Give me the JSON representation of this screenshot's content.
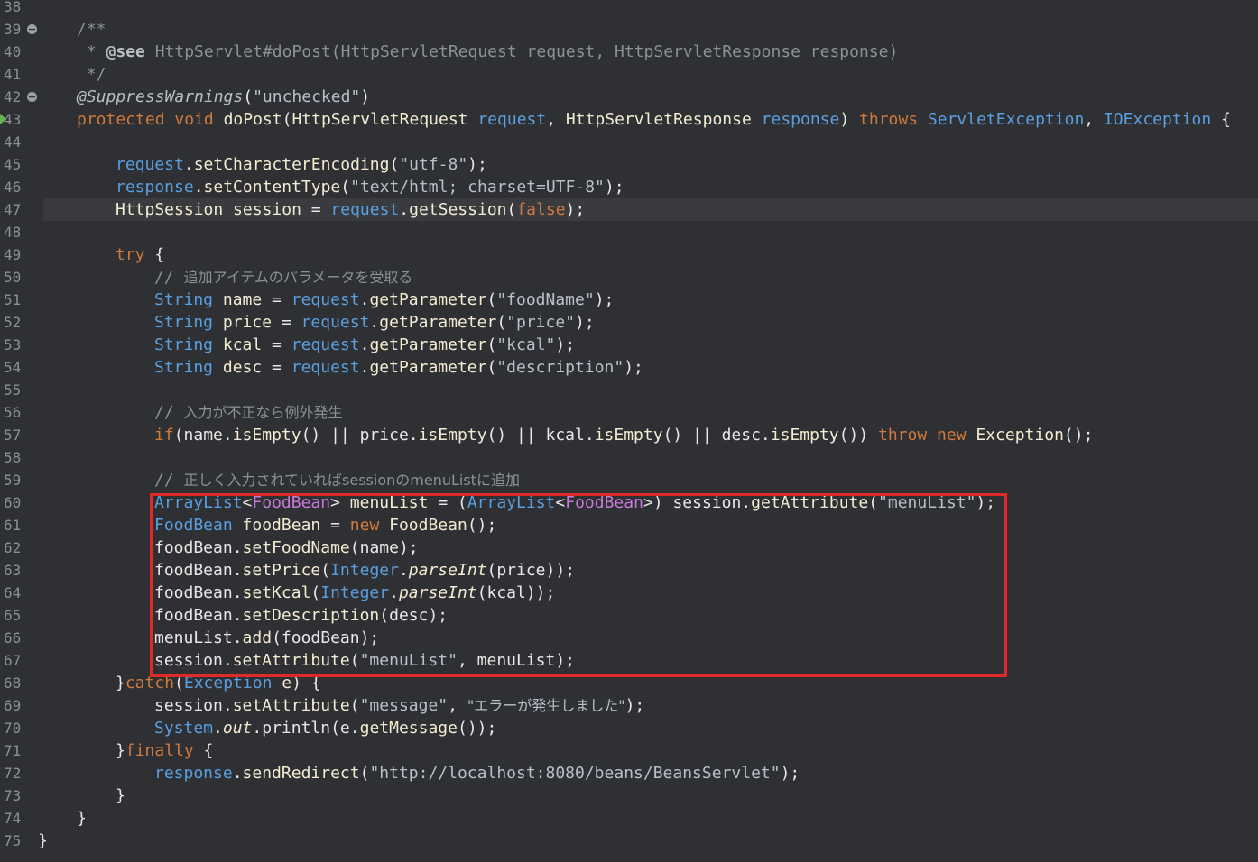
{
  "colors": {
    "background": "#2f3033",
    "highlight_box": "#e02a2a",
    "keyword": "#d07a3e",
    "type": "#5a9fe0",
    "comment": "#8c9196"
  },
  "gutter": {
    "fold_markers": [
      39,
      42
    ],
    "breakpoint_marker_line": 43
  },
  "current_line": 47,
  "highlight_box_lines": [
    60,
    67
  ],
  "lines": [
    {
      "n": "38",
      "indent": 0,
      "tokens": []
    },
    {
      "n": "39",
      "indent": 1,
      "tokens": [
        {
          "c": "doc",
          "t": "/**"
        }
      ]
    },
    {
      "n": "40",
      "indent": 1,
      "tokens": [
        {
          "c": "doc",
          "t": " * "
        },
        {
          "c": "doctag",
          "t": "@see"
        },
        {
          "c": "doc",
          "t": " HttpServlet#doPost(HttpServletRequest request, HttpServletResponse response)"
        }
      ]
    },
    {
      "n": "41",
      "indent": 1,
      "tokens": [
        {
          "c": "doc",
          "t": " */"
        }
      ]
    },
    {
      "n": "42",
      "indent": 1,
      "tokens": [
        {
          "c": "annotation",
          "t": "@SuppressWarnings"
        },
        {
          "c": "plain",
          "t": "("
        },
        {
          "c": "string",
          "t": "\"unchecked\""
        },
        {
          "c": "plain",
          "t": ")"
        }
      ]
    },
    {
      "n": "43",
      "indent": 1,
      "tokens": [
        {
          "c": "keyword",
          "t": "protected void "
        },
        {
          "c": "method",
          "t": "doPost"
        },
        {
          "c": "plain",
          "t": "("
        },
        {
          "c": "var",
          "t": "HttpServletRequest "
        },
        {
          "c": "type",
          "t": "request"
        },
        {
          "c": "plain",
          "t": ", "
        },
        {
          "c": "var",
          "t": "HttpServletResponse "
        },
        {
          "c": "type",
          "t": "response"
        },
        {
          "c": "plain",
          "t": ") "
        },
        {
          "c": "keyword",
          "t": "throws "
        },
        {
          "c": "type",
          "t": "ServletException"
        },
        {
          "c": "plain",
          "t": ", "
        },
        {
          "c": "type",
          "t": "IOException"
        },
        {
          "c": "plain",
          "t": " {"
        }
      ]
    },
    {
      "n": "44",
      "indent": 0,
      "tokens": []
    },
    {
      "n": "45",
      "indent": 2,
      "tokens": [
        {
          "c": "type",
          "t": "request"
        },
        {
          "c": "plain",
          "t": "."
        },
        {
          "c": "method",
          "t": "setCharacterEncoding"
        },
        {
          "c": "plain",
          "t": "("
        },
        {
          "c": "string",
          "t": "\"utf-8\""
        },
        {
          "c": "plain",
          "t": ");"
        }
      ]
    },
    {
      "n": "46",
      "indent": 2,
      "tokens": [
        {
          "c": "type",
          "t": "response"
        },
        {
          "c": "plain",
          "t": "."
        },
        {
          "c": "method",
          "t": "setContentType"
        },
        {
          "c": "plain",
          "t": "("
        },
        {
          "c": "string",
          "t": "\"text/html; charset=UTF-8\""
        },
        {
          "c": "plain",
          "t": ");"
        }
      ]
    },
    {
      "n": "47",
      "indent": 2,
      "tokens": [
        {
          "c": "var",
          "t": "HttpSession "
        },
        {
          "c": "var",
          "t": "session"
        },
        {
          "c": "plain",
          "t": " = "
        },
        {
          "c": "type",
          "t": "request"
        },
        {
          "c": "plain",
          "t": "."
        },
        {
          "c": "method",
          "t": "getSession"
        },
        {
          "c": "plain",
          "t": "("
        },
        {
          "c": "keyword",
          "t": "false"
        },
        {
          "c": "plain",
          "t": ");"
        }
      ]
    },
    {
      "n": "48",
      "indent": 0,
      "tokens": []
    },
    {
      "n": "49",
      "indent": 2,
      "tokens": [
        {
          "c": "keyword",
          "t": "try"
        },
        {
          "c": "plain",
          "t": " {"
        }
      ]
    },
    {
      "n": "50",
      "indent": 3,
      "tokens": [
        {
          "c": "comment",
          "t": "// "
        },
        {
          "c": "comment jp",
          "t": "追加アイテムのパラメータを受取る"
        }
      ]
    },
    {
      "n": "51",
      "indent": 3,
      "tokens": [
        {
          "c": "type",
          "t": "String "
        },
        {
          "c": "var",
          "t": "name"
        },
        {
          "c": "plain",
          "t": " = "
        },
        {
          "c": "type",
          "t": "request"
        },
        {
          "c": "plain",
          "t": "."
        },
        {
          "c": "method",
          "t": "getParameter"
        },
        {
          "c": "plain",
          "t": "("
        },
        {
          "c": "string",
          "t": "\"foodName\""
        },
        {
          "c": "plain",
          "t": ");"
        }
      ]
    },
    {
      "n": "52",
      "indent": 3,
      "tokens": [
        {
          "c": "type",
          "t": "String "
        },
        {
          "c": "var",
          "t": "price"
        },
        {
          "c": "plain",
          "t": " = "
        },
        {
          "c": "type",
          "t": "request"
        },
        {
          "c": "plain",
          "t": "."
        },
        {
          "c": "method",
          "t": "getParameter"
        },
        {
          "c": "plain",
          "t": "("
        },
        {
          "c": "string",
          "t": "\"price\""
        },
        {
          "c": "plain",
          "t": ");"
        }
      ]
    },
    {
      "n": "53",
      "indent": 3,
      "tokens": [
        {
          "c": "type",
          "t": "String "
        },
        {
          "c": "var",
          "t": "kcal"
        },
        {
          "c": "plain",
          "t": " = "
        },
        {
          "c": "type",
          "t": "request"
        },
        {
          "c": "plain",
          "t": "."
        },
        {
          "c": "method",
          "t": "getParameter"
        },
        {
          "c": "plain",
          "t": "("
        },
        {
          "c": "string",
          "t": "\"kcal\""
        },
        {
          "c": "plain",
          "t": ");"
        }
      ]
    },
    {
      "n": "54",
      "indent": 3,
      "tokens": [
        {
          "c": "type",
          "t": "String "
        },
        {
          "c": "var",
          "t": "desc"
        },
        {
          "c": "plain",
          "t": " = "
        },
        {
          "c": "type",
          "t": "request"
        },
        {
          "c": "plain",
          "t": "."
        },
        {
          "c": "method",
          "t": "getParameter"
        },
        {
          "c": "plain",
          "t": "("
        },
        {
          "c": "string",
          "t": "\"description\""
        },
        {
          "c": "plain",
          "t": ");"
        }
      ]
    },
    {
      "n": "55",
      "indent": 0,
      "tokens": []
    },
    {
      "n": "56",
      "indent": 3,
      "tokens": [
        {
          "c": "comment",
          "t": "// "
        },
        {
          "c": "comment jp",
          "t": "入力が不正なら例外発生"
        }
      ]
    },
    {
      "n": "57",
      "indent": 3,
      "tokens": [
        {
          "c": "keyword",
          "t": "if"
        },
        {
          "c": "plain",
          "t": "(name."
        },
        {
          "c": "method",
          "t": "isEmpty"
        },
        {
          "c": "plain",
          "t": "() || price."
        },
        {
          "c": "method",
          "t": "isEmpty"
        },
        {
          "c": "plain",
          "t": "() || kcal."
        },
        {
          "c": "method",
          "t": "isEmpty"
        },
        {
          "c": "plain",
          "t": "() || desc."
        },
        {
          "c": "method",
          "t": "isEmpty"
        },
        {
          "c": "plain",
          "t": "()) "
        },
        {
          "c": "keyword",
          "t": "throw new "
        },
        {
          "c": "var",
          "t": "Exception"
        },
        {
          "c": "plain",
          "t": "();"
        }
      ]
    },
    {
      "n": "58",
      "indent": 0,
      "tokens": []
    },
    {
      "n": "59",
      "indent": 3,
      "tokens": [
        {
          "c": "comment",
          "t": "// "
        },
        {
          "c": "comment jp",
          "t": "正しく入力されていればsessionのmenuListに追加"
        }
      ]
    },
    {
      "n": "60",
      "indent": 3,
      "tokens": [
        {
          "c": "type",
          "t": "ArrayList"
        },
        {
          "c": "plain",
          "t": "<"
        },
        {
          "c": "typeparam",
          "t": "FoodBean"
        },
        {
          "c": "plain",
          "t": "> "
        },
        {
          "c": "var",
          "t": "menuList"
        },
        {
          "c": "plain",
          "t": " = ("
        },
        {
          "c": "type",
          "t": "ArrayList"
        },
        {
          "c": "plain",
          "t": "<"
        },
        {
          "c": "typeparam",
          "t": "FoodBean"
        },
        {
          "c": "plain",
          "t": ">) session."
        },
        {
          "c": "method",
          "t": "getAttribute"
        },
        {
          "c": "plain",
          "t": "("
        },
        {
          "c": "string",
          "t": "\"menuList\""
        },
        {
          "c": "plain",
          "t": ");"
        }
      ]
    },
    {
      "n": "61",
      "indent": 3,
      "tokens": [
        {
          "c": "type",
          "t": "FoodBean "
        },
        {
          "c": "var",
          "t": "foodBean"
        },
        {
          "c": "plain",
          "t": " = "
        },
        {
          "c": "keyword",
          "t": "new "
        },
        {
          "c": "var",
          "t": "FoodBean"
        },
        {
          "c": "plain",
          "t": "();"
        }
      ]
    },
    {
      "n": "62",
      "indent": 3,
      "tokens": [
        {
          "c": "plain",
          "t": "foodBean."
        },
        {
          "c": "method",
          "t": "setFoodName"
        },
        {
          "c": "plain",
          "t": "(name);"
        }
      ]
    },
    {
      "n": "63",
      "indent": 3,
      "tokens": [
        {
          "c": "plain",
          "t": "foodBean."
        },
        {
          "c": "method",
          "t": "setPrice"
        },
        {
          "c": "plain",
          "t": "("
        },
        {
          "c": "type",
          "t": "Integer"
        },
        {
          "c": "plain",
          "t": "."
        },
        {
          "c": "staticmethod",
          "t": "parseInt"
        },
        {
          "c": "plain",
          "t": "(price));"
        }
      ]
    },
    {
      "n": "64",
      "indent": 3,
      "tokens": [
        {
          "c": "plain",
          "t": "foodBean."
        },
        {
          "c": "method",
          "t": "setKcal"
        },
        {
          "c": "plain",
          "t": "("
        },
        {
          "c": "type",
          "t": "Integer"
        },
        {
          "c": "plain",
          "t": "."
        },
        {
          "c": "staticmethod",
          "t": "parseInt"
        },
        {
          "c": "plain",
          "t": "(kcal));"
        }
      ]
    },
    {
      "n": "65",
      "indent": 3,
      "tokens": [
        {
          "c": "plain",
          "t": "foodBean."
        },
        {
          "c": "method",
          "t": "setDescription"
        },
        {
          "c": "plain",
          "t": "(desc);"
        }
      ]
    },
    {
      "n": "66",
      "indent": 3,
      "tokens": [
        {
          "c": "plain",
          "t": "menuList."
        },
        {
          "c": "method",
          "t": "add"
        },
        {
          "c": "plain",
          "t": "(foodBean);"
        }
      ]
    },
    {
      "n": "67",
      "indent": 3,
      "tokens": [
        {
          "c": "plain",
          "t": "session."
        },
        {
          "c": "method",
          "t": "setAttribute"
        },
        {
          "c": "plain",
          "t": "("
        },
        {
          "c": "string",
          "t": "\"menuList\""
        },
        {
          "c": "plain",
          "t": ", menuList);"
        }
      ]
    },
    {
      "n": "68",
      "indent": 2,
      "tokens": [
        {
          "c": "plain",
          "t": "}"
        },
        {
          "c": "keyword",
          "t": "catch"
        },
        {
          "c": "plain",
          "t": "("
        },
        {
          "c": "type",
          "t": "Exception "
        },
        {
          "c": "var",
          "t": "e"
        },
        {
          "c": "plain",
          "t": ") {"
        }
      ]
    },
    {
      "n": "69",
      "indent": 3,
      "tokens": [
        {
          "c": "plain",
          "t": "session."
        },
        {
          "c": "method",
          "t": "setAttribute"
        },
        {
          "c": "plain",
          "t": "("
        },
        {
          "c": "string",
          "t": "\"message\""
        },
        {
          "c": "plain",
          "t": ", "
        },
        {
          "c": "string jp",
          "t": "\"エラーが発生しました\""
        },
        {
          "c": "plain",
          "t": ");"
        }
      ]
    },
    {
      "n": "70",
      "indent": 3,
      "tokens": [
        {
          "c": "type",
          "t": "System"
        },
        {
          "c": "plain",
          "t": "."
        },
        {
          "c": "var italic",
          "t": "out"
        },
        {
          "c": "plain",
          "t": ".println(e."
        },
        {
          "c": "method",
          "t": "getMessage"
        },
        {
          "c": "plain",
          "t": "());"
        }
      ]
    },
    {
      "n": "71",
      "indent": 2,
      "tokens": [
        {
          "c": "plain",
          "t": "}"
        },
        {
          "c": "keyword",
          "t": "finally"
        },
        {
          "c": "plain",
          "t": " {"
        }
      ]
    },
    {
      "n": "72",
      "indent": 3,
      "tokens": [
        {
          "c": "type",
          "t": "response"
        },
        {
          "c": "plain",
          "t": "."
        },
        {
          "c": "method",
          "t": "sendRedirect"
        },
        {
          "c": "plain",
          "t": "("
        },
        {
          "c": "string",
          "t": "\"http://localhost:8080/beans/BeansServlet\""
        },
        {
          "c": "plain",
          "t": ");"
        }
      ]
    },
    {
      "n": "73",
      "indent": 2,
      "tokens": [
        {
          "c": "plain",
          "t": "}"
        }
      ]
    },
    {
      "n": "74",
      "indent": 1,
      "tokens": [
        {
          "c": "plain",
          "t": "}"
        }
      ]
    },
    {
      "n": "75",
      "indent": 0,
      "tokens": [
        {
          "c": "plain",
          "t": "}"
        }
      ]
    }
  ]
}
